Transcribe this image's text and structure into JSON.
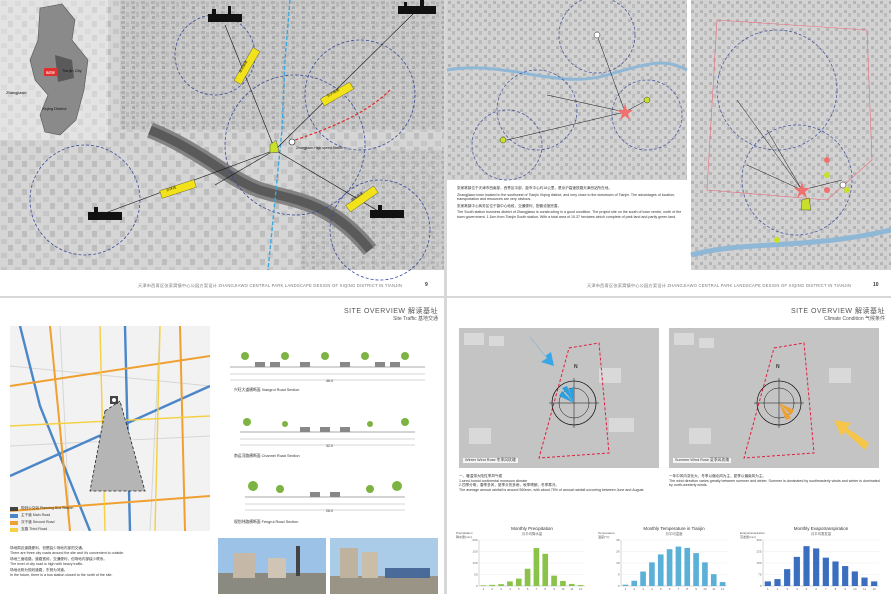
{
  "page1": {
    "footer": "天津市西青区张家窝镇中心公园方案设计 ZHANGJIAWO CENTRAL PARK LANDSCAPE DESIGN OF XIQING DISTRICT IN TIANJIN",
    "page_number": "9",
    "inset": {
      "site_label": "SITE",
      "city_label": "Tianjin City",
      "town_label": "Zhangjiawo",
      "district_label": "Xiqing District"
    },
    "road_labels": [
      "津沧高速",
      "京沪高速",
      "外环线",
      "荣乌高速"
    ],
    "station_label": "Zhangjiawo High-speed Station"
  },
  "page2": {
    "footer": "天津市西青区张家窝镇中心公园方案设计 ZHANGJIAWO CENTRAL PARK LANDSCAPE DESIGN OF XIQING DISTRICT IN TIANJIN",
    "page_number": "10",
    "text_cn_1": "张家窝镇位于天津市西南部，西青区中部，距市中心约18公里，是京沪高速铁路天津西站所在地。",
    "text_en_1": "Zhangjiawo town located in the southwest of Tianjin Xiqing district, and very close to the downtown of Tianjin. The advantages of location, transportation and resources are very obvious.",
    "text_cn_2": "张家窝镇中心商务区位于镇中心地段，交通便利，配套设施完善。",
    "text_en_2": "The South station business district of Zhangjiawo is constructing in a good condition. The project site on the south of town centre, north of the town government, 1.1km from Tianjin South station. With a total area of 10.37 hectares which complete of park land and partly green land."
  },
  "page3": {
    "title": "SITE OVERVIEW 解读基址",
    "subtitle": "Site Traffic 基地交通",
    "legend": [
      {
        "label": "规划公交站 Planning Bus Station",
        "color": "#444444"
      },
      {
        "label": "主干道 Main Road",
        "color": "#4a86c8"
      },
      {
        "label": "次干道 Second Road",
        "color": "#f0a030"
      },
      {
        "label": "支路 Third Road",
        "color": "#f5d040"
      }
    ],
    "road_sections": [
      {
        "caption": "兴旺大道横断面 Xiangrui Road Section",
        "total": "46.0"
      },
      {
        "caption": "南运河路横断面 Channel Road Section",
        "total": "32.0"
      },
      {
        "caption": "规划纬路横断面 Fengrui Road Section",
        "total": "26.0"
      }
    ],
    "notes": [
      "场地周边道路便利，但是缺少场地内部的交通。",
      "There are three city roads around the site and it's convenient to outside.",
      "场地三面临路，道路宽阔，交通便利，但场地内部缺少联系。",
      "The level of city road is high with heavy traffic.",
      "场地北侧为规划道路，东侧为河道。",
      "In the future, there is a bus station closed to the north of the site."
    ]
  },
  "page4": {
    "title": "SITE OVERVIEW 解读基址",
    "subtitle": "Climate Condition 气候条件",
    "wind_left_caption": "Winter Wind Rose 冬季风玫瑰",
    "wind_right_caption": "Summer Wind Rose 夏季风玫瑰",
    "north_label": "N",
    "notes_left": [
      "一、暖温带大陆性季风气候",
      "1.semi-humid continental monsoon climate",
      "2.四季分明，春季多风，夏季炎热多雨，秋季晴朗，冬季寒冷。",
      "The average annual rainfall is around 550mm, with about 75% of annual rainfall occurring between June and August."
    ],
    "notes_right": [
      "一年中风向变化大，冬季以偏北风为主，夏季以偏南风为主。",
      "The wind direction varies greatly between summer and winter. Summer is dominated by southeasterly winds and winter is dominated by north-westerly winds."
    ]
  },
  "chart_data": [
    {
      "type": "bar",
      "title": "Monthly Precipitation",
      "subtitle": "月平均降水量",
      "ylabel": "Precipitation\n降水量(mm)",
      "categories": [
        "1",
        "2",
        "3",
        "4",
        "5",
        "6",
        "7",
        "8",
        "9",
        "10",
        "11",
        "12"
      ],
      "values": [
        3,
        5,
        8,
        20,
        32,
        75,
        165,
        140,
        45,
        22,
        9,
        4
      ],
      "ylim": [
        0,
        200
      ],
      "color": "#8bc34a"
    },
    {
      "type": "bar",
      "title": "Monthly Temperature in Tianjin",
      "subtitle": "月平均温度",
      "ylabel": "Temperature\n温度(°C)",
      "categories": [
        "1",
        "2",
        "3",
        "4",
        "5",
        "6",
        "7",
        "8",
        "9",
        "10",
        "11",
        "12"
      ],
      "values": [
        1,
        4,
        11,
        18,
        24,
        28,
        30,
        29,
        25,
        18,
        9,
        3
      ],
      "ylim": [
        0,
        35
      ],
      "color": "#5bb0d8"
    },
    {
      "type": "bar",
      "title": "Monthly Evapotranspiration",
      "subtitle": "月平均蒸发量",
      "ylabel": "Evapotranspiration\n蒸发量(mm)",
      "categories": [
        "1",
        "2",
        "3",
        "4",
        "5",
        "6",
        "7",
        "8",
        "9",
        "10",
        "11",
        "12"
      ],
      "values": [
        30,
        45,
        110,
        190,
        260,
        245,
        185,
        160,
        130,
        95,
        55,
        30
      ],
      "ylim": [
        0,
        300
      ],
      "color": "#3a6ebf"
    }
  ]
}
